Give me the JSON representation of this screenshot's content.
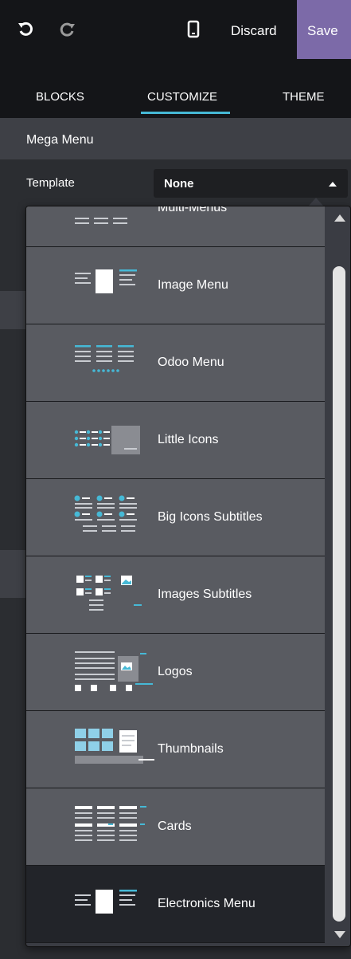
{
  "toolbar": {
    "undo_icon": "undo-icon",
    "redo_icon": "redo-icon",
    "mobile_icon": "mobile-preview-icon",
    "discard_label": "Discard",
    "save_label": "Save",
    "save_color": "#7c6aa8"
  },
  "tabs": [
    {
      "label": "BLOCKS",
      "active": false
    },
    {
      "label": "CUSTOMIZE",
      "active": true
    },
    {
      "label": "THEME",
      "active": false
    }
  ],
  "accent_color": "#46b9d6",
  "section": {
    "title": "Mega Menu",
    "option_label": "Template",
    "option_value": "None"
  },
  "dropdown": {
    "items": [
      {
        "label": "Multi-Menus",
        "icon": "multi-menus-icon",
        "active": false
      },
      {
        "label": "Image Menu",
        "icon": "image-menu-icon",
        "active": false
      },
      {
        "label": "Odoo Menu",
        "icon": "odoo-menu-icon",
        "active": false
      },
      {
        "label": "Little Icons",
        "icon": "little-icons-icon",
        "active": false
      },
      {
        "label": "Big Icons Subtitles",
        "icon": "big-icons-subtitles-icon",
        "active": false
      },
      {
        "label": "Images Subtitles",
        "icon": "images-subtitles-icon",
        "active": false
      },
      {
        "label": "Logos",
        "icon": "logos-icon",
        "active": false
      },
      {
        "label": "Thumbnails",
        "icon": "thumbnails-icon",
        "active": false
      },
      {
        "label": "Cards",
        "icon": "cards-icon",
        "active": false
      },
      {
        "label": "Electronics Menu",
        "icon": "electronics-menu-icon",
        "active": true
      }
    ]
  }
}
